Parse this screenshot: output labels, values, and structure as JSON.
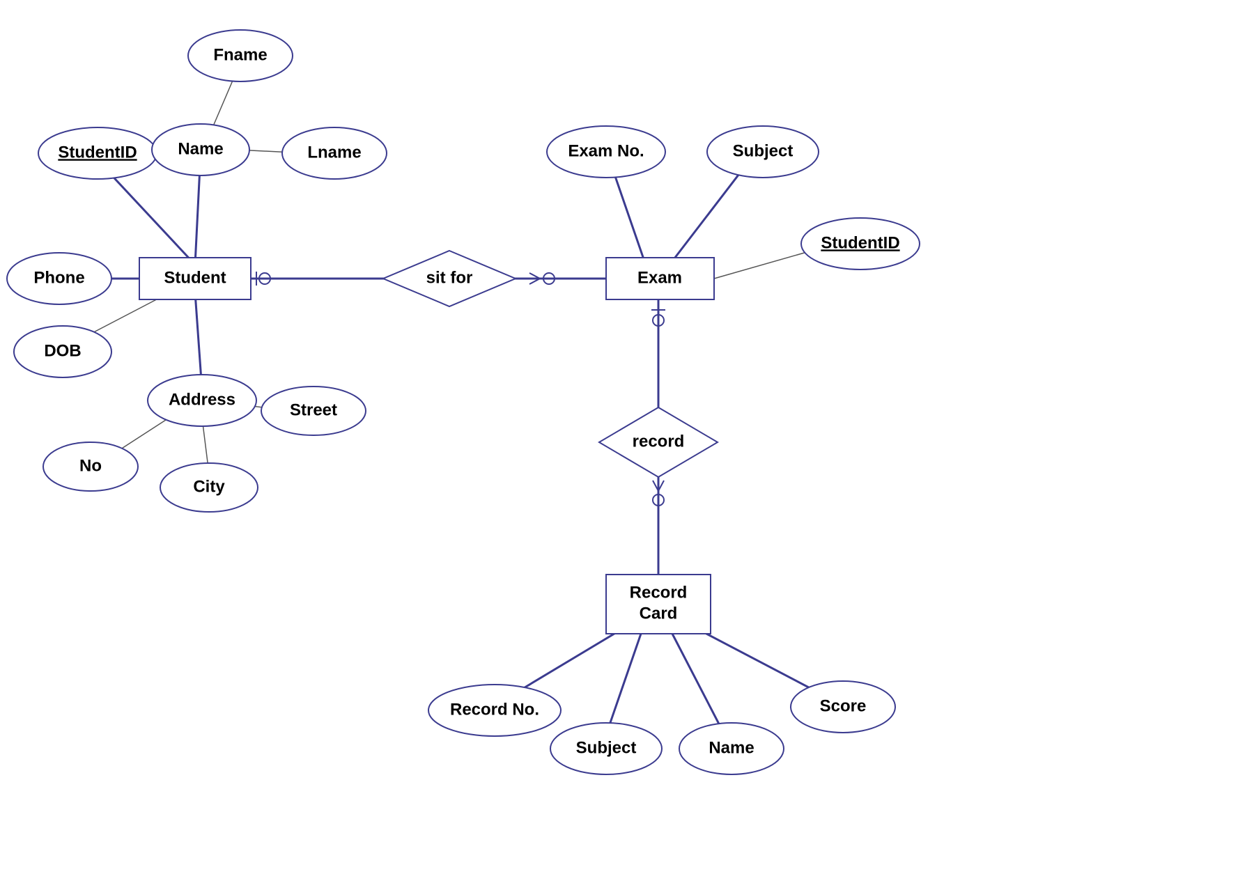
{
  "entities": {
    "student": "Student",
    "exam": "Exam",
    "record_card_l1": "Record",
    "record_card_l2": "Card"
  },
  "relationships": {
    "sit_for": "sit for",
    "record": "record"
  },
  "attributes": {
    "student_id": "StudentID",
    "name": "Name",
    "fname": "Fname",
    "lname": "Lname",
    "phone": "Phone",
    "dob": "DOB",
    "address": "Address",
    "no": "No",
    "city": "City",
    "street": "Street",
    "exam_no": "Exam No.",
    "subject_exam": "Subject",
    "exam_student_id": "StudentID",
    "record_no": "Record No.",
    "subject_record": "Subject",
    "name_record": "Name",
    "score": "Score"
  }
}
